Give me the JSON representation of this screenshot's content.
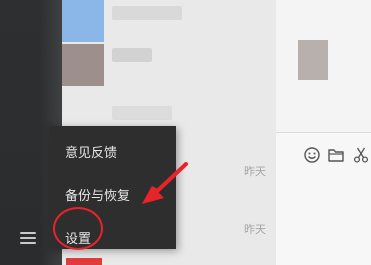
{
  "popup_menu": {
    "items": [
      {
        "label": "意见反馈"
      },
      {
        "label": "备份与恢复"
      },
      {
        "label": "设置"
      }
    ]
  },
  "chat_list": {
    "times": [
      "昨天",
      "昨天"
    ]
  },
  "icons": {
    "menu": "hamburger-icon",
    "emoji": "smiley-icon",
    "folder": "folder-icon",
    "scissors": "scissors-icon"
  },
  "colors": {
    "nav_rail": "#2d2f31",
    "popup_bg": "#2e2e2e",
    "highlight_red": "#e8242b"
  }
}
